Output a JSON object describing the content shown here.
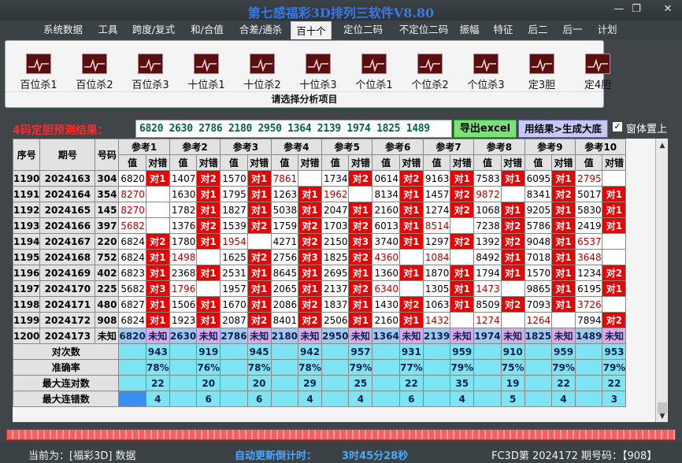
{
  "app": {
    "title": "第七感福彩3D排列三软件V8.80",
    "min": "—",
    "max": "❐",
    "close": "✕"
  },
  "menu": [
    "系统数据",
    "工具",
    "跨度/复式",
    "和/合值",
    "合差/通杀",
    "百十个",
    "定位二码",
    "不定位二码",
    "振幅",
    "特征",
    "后二",
    "后一",
    "计划"
  ],
  "menu_active": 5,
  "ribbon": {
    "buttons": [
      "百位杀1",
      "百位杀2",
      "百位杀3",
      "十位杀1",
      "十位杀2",
      "十位杀3",
      "个位杀1",
      "个位杀2",
      "个位杀3",
      "定3胆",
      "定4胆"
    ],
    "caption": "请选择分析项目"
  },
  "result": {
    "label": "4码定胆预测结果：",
    "prediction": "6820  2630  2786  2180  2950  1364  2139  1974  1825  1489",
    "btn_excel": "导出excel",
    "btn_gen": "用结果>生成大底",
    "chk_mark": "✓",
    "chk_label": "窗体置上"
  },
  "table": {
    "col_seq": "序号",
    "col_period": "期号",
    "col_code": "号码",
    "refs": [
      "参考1",
      "参考2",
      "参考3",
      "参考4",
      "参考5",
      "参考6",
      "参考7",
      "参考8",
      "参考9",
      "参考10"
    ],
    "sub_val": "值",
    "sub_ok": "对错",
    "rows": [
      {
        "seq": "1190",
        "period": "2024163",
        "code": "304",
        "cells": [
          [
            "6820",
            "对1"
          ],
          [
            "1407",
            "对2"
          ],
          [
            "1570",
            "对1"
          ],
          [
            "7861",
            ""
          ],
          [
            "1734",
            "对2"
          ],
          [
            "0614",
            "对2"
          ],
          [
            "9163",
            "对1"
          ],
          [
            "7583",
            "对1"
          ],
          [
            "6095",
            "对1"
          ],
          [
            "2795",
            ""
          ]
        ],
        "red": [
          0,
          0,
          0,
          1,
          0,
          0,
          0,
          0,
          0,
          1
        ]
      },
      {
        "seq": "1191",
        "period": "2024164",
        "code": "354",
        "cells": [
          [
            "8270",
            ""
          ],
          [
            "1630",
            "对1"
          ],
          [
            "1795",
            "对1"
          ],
          [
            "1263",
            "对1"
          ],
          [
            "1962",
            ""
          ],
          [
            "8134",
            "对1"
          ],
          [
            "1457",
            "对2"
          ],
          [
            "9872",
            ""
          ],
          [
            "8341",
            "对2"
          ],
          [
            "5017",
            "对1"
          ]
        ],
        "red": [
          1,
          0,
          0,
          0,
          1,
          0,
          0,
          1,
          0,
          0
        ]
      },
      {
        "seq": "1192",
        "period": "2024165",
        "code": "145",
        "cells": [
          [
            "8270",
            ""
          ],
          [
            "1782",
            "对1"
          ],
          [
            "1827",
            "对1"
          ],
          [
            "5038",
            "对1"
          ],
          [
            "2047",
            "对1"
          ],
          [
            "2160",
            "对1"
          ],
          [
            "1274",
            "对2"
          ],
          [
            "1068",
            "对1"
          ],
          [
            "9205",
            "对1"
          ],
          [
            "5830",
            "对1"
          ]
        ],
        "red": [
          1,
          0,
          0,
          0,
          0,
          0,
          0,
          0,
          0,
          0
        ]
      },
      {
        "seq": "1193",
        "period": "2024166",
        "code": "397",
        "cells": [
          [
            "5682",
            ""
          ],
          [
            "1376",
            "对2"
          ],
          [
            "1539",
            "对2"
          ],
          [
            "1759",
            "对2"
          ],
          [
            "1703",
            "对2"
          ],
          [
            "6013",
            "对1"
          ],
          [
            "8514",
            ""
          ],
          [
            "7238",
            "对2"
          ],
          [
            "5786",
            "对1"
          ],
          [
            "2419",
            "对1"
          ]
        ],
        "red": [
          1,
          0,
          0,
          0,
          0,
          0,
          1,
          0,
          0,
          0
        ]
      },
      {
        "seq": "1194",
        "period": "2024167",
        "code": "220",
        "cells": [
          [
            "6824",
            "对2"
          ],
          [
            "1780",
            "对1"
          ],
          [
            "1954",
            ""
          ],
          [
            "4271",
            "对2"
          ],
          [
            "2150",
            "对3"
          ],
          [
            "3740",
            "对1"
          ],
          [
            "1297",
            "对2"
          ],
          [
            "1392",
            "对2"
          ],
          [
            "9048",
            "对1"
          ],
          [
            "6537",
            ""
          ]
        ],
        "red": [
          0,
          0,
          1,
          0,
          0,
          0,
          0,
          0,
          0,
          1
        ]
      },
      {
        "seq": "1195",
        "period": "2024168",
        "code": "752",
        "cells": [
          [
            "6824",
            "对1"
          ],
          [
            "1498",
            ""
          ],
          [
            "1625",
            "对2"
          ],
          [
            "2756",
            "对3"
          ],
          [
            "1825",
            "对2"
          ],
          [
            "4360",
            ""
          ],
          [
            "1084",
            ""
          ],
          [
            "8492",
            "对1"
          ],
          [
            "7018",
            "对1"
          ],
          [
            "3648",
            ""
          ]
        ],
        "red": [
          0,
          1,
          0,
          0,
          0,
          1,
          1,
          0,
          0,
          1
        ]
      },
      {
        "seq": "1196",
        "period": "2024169",
        "code": "402",
        "cells": [
          [
            "6823",
            "对1"
          ],
          [
            "2368",
            "对1"
          ],
          [
            "2531",
            "对1"
          ],
          [
            "8645",
            "对1"
          ],
          [
            "2695",
            "对1"
          ],
          [
            "1360",
            "对1"
          ],
          [
            "1870",
            "对1"
          ],
          [
            "1794",
            "对1"
          ],
          [
            "1570",
            "对1"
          ],
          [
            "1234",
            "对2"
          ]
        ],
        "red": [
          0,
          0,
          0,
          0,
          0,
          0,
          0,
          0,
          0,
          0
        ]
      },
      {
        "seq": "1197",
        "period": "2024170",
        "code": "225",
        "cells": [
          [
            "5682",
            "对3"
          ],
          [
            "1796",
            ""
          ],
          [
            "1957",
            "对1"
          ],
          [
            "2065",
            "对1"
          ],
          [
            "2137",
            "对2"
          ],
          [
            "6340",
            ""
          ],
          [
            "1305",
            "对1"
          ],
          [
            "1473",
            ""
          ],
          [
            "9865",
            "对1"
          ],
          [
            "6195",
            "对1"
          ]
        ],
        "red": [
          0,
          1,
          0,
          0,
          0,
          1,
          0,
          1,
          0,
          0
        ]
      },
      {
        "seq": "1198",
        "period": "2024171",
        "code": "480",
        "cells": [
          [
            "6827",
            "对1"
          ],
          [
            "1506",
            "对1"
          ],
          [
            "1670",
            "对1"
          ],
          [
            "2086",
            "对2"
          ],
          [
            "1837",
            "对1"
          ],
          [
            "1430",
            "对2"
          ],
          [
            "1063",
            "对1"
          ],
          [
            "8509",
            "对2"
          ],
          [
            "7093",
            "对1"
          ],
          [
            "3726",
            ""
          ]
        ],
        "red": [
          0,
          0,
          0,
          0,
          0,
          0,
          0,
          0,
          0,
          1
        ]
      },
      {
        "seq": "1199",
        "period": "2024172",
        "code": "908",
        "cells": [
          [
            "6824",
            "对1"
          ],
          [
            "1923",
            "对1"
          ],
          [
            "2087",
            "对2"
          ],
          [
            "8401",
            "对2"
          ],
          [
            "2506",
            "对1"
          ],
          [
            "2160",
            "对1"
          ],
          [
            "1432",
            ""
          ],
          [
            "1274",
            ""
          ],
          [
            "1264",
            ""
          ],
          [
            "7894",
            "对2"
          ]
        ],
        "red": [
          0,
          0,
          0,
          0,
          0,
          0,
          1,
          1,
          1,
          0
        ]
      }
    ],
    "pending": {
      "seq": "1200",
      "period": "2024173",
      "code": "未知",
      "vals": [
        "6820",
        "2630",
        "2786",
        "2180",
        "2950",
        "1364",
        "2139",
        "1974",
        "1825",
        "1489"
      ],
      "mark": "未知"
    },
    "stats": [
      {
        "label": "对次数",
        "vals": [
          "943",
          "919",
          "945",
          "942",
          "957",
          "931",
          "959",
          "910",
          "959",
          "953"
        ]
      },
      {
        "label": "准确率",
        "vals": [
          "78%",
          "76%",
          "78%",
          "78%",
          "79%",
          "77%",
          "79%",
          "75%",
          "79%",
          "79%"
        ]
      },
      {
        "label": "最大连对数",
        "vals": [
          "22",
          "20",
          "20",
          "29",
          "25",
          "22",
          "35",
          "19",
          "22",
          "22"
        ]
      },
      {
        "label": "最大连错数",
        "vals": [
          "4",
          "6",
          "6",
          "4",
          "4",
          "6",
          "4",
          "5",
          "4",
          "3"
        ]
      }
    ]
  },
  "status": {
    "left": "当前为：[福彩3D] 数据",
    "mid_label": "自动更新倒计时：",
    "mid_time": "3时45分28秒",
    "right": "FC3D第 2024172 期号码：【908】"
  }
}
